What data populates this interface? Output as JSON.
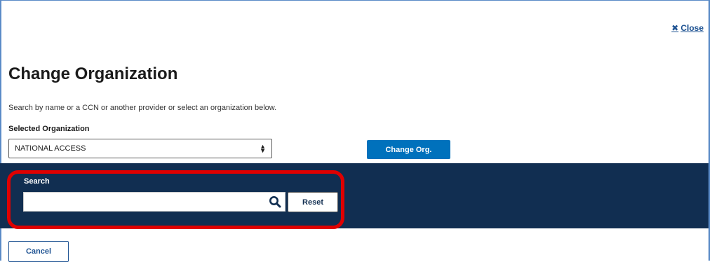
{
  "dialog": {
    "close_label": "Close",
    "title": "Change Organization",
    "instructions": "Search by name or a CCN or another provider or select an organization below.",
    "selected_org_label": "Selected Organization",
    "selected_org_value": "NATIONAL ACCESS",
    "change_button": "Change Org.",
    "cancel_button": "Cancel"
  },
  "search": {
    "label": "Search",
    "value": "",
    "placeholder": "",
    "reset_button": "Reset"
  },
  "colors": {
    "panel_bg": "#112e51",
    "primary_button": "#0071bc",
    "highlight": "#e00000"
  }
}
